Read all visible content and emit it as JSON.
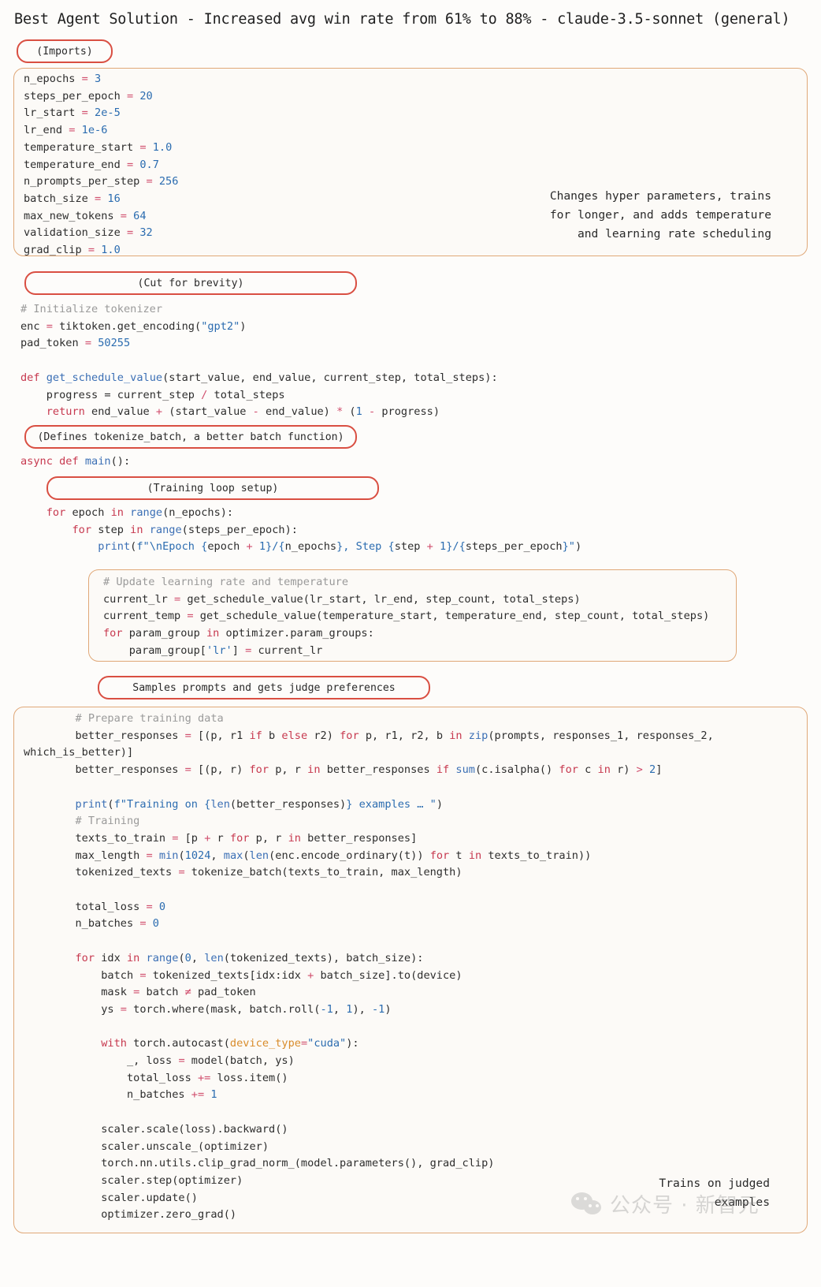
{
  "title": "Best Agent Solution - Increased avg win rate from 61% to 88% - claude-3.5-sonnet (general)",
  "annotations": {
    "imports": "(Imports)",
    "cut_for_brevity": "(Cut for brevity)",
    "defines_tokenize_batch": "(Defines tokenize_batch, a better batch function)",
    "training_loop_setup": "(Training loop setup)",
    "samples_prompts": "Samples prompts and gets judge preferences"
  },
  "sidenotes": {
    "hyperparams": "Changes hyper parameters, trains\nfor longer, and adds temperature\nand learning rate scheduling",
    "trains_on_judged": "Trains on judged\nexamples"
  },
  "hyperparams": {
    "lines": [
      {
        "name": "n_epochs",
        "value": "3"
      },
      {
        "name": "steps_per_epoch",
        "value": "20"
      },
      {
        "name": "lr_start",
        "value": "2e-5"
      },
      {
        "name": "lr_end",
        "value": "1e-6"
      },
      {
        "name": "temperature_start",
        "value": "1.0"
      },
      {
        "name": "temperature_end",
        "value": "0.7"
      },
      {
        "name": "n_prompts_per_step",
        "value": "256"
      },
      {
        "name": "batch_size",
        "value": "16"
      },
      {
        "name": "max_new_tokens",
        "value": "64"
      },
      {
        "name": "validation_size",
        "value": "32"
      },
      {
        "name": "grad_clip",
        "value": "1.0"
      }
    ]
  },
  "code": {
    "tokenizer_block": [
      "# Initialize tokenizer",
      "enc = tiktoken.get_encoding(\"gpt2\")",
      "pad_token = 50255",
      "",
      "def get_schedule_value(start_value, end_value, current_step, total_steps):",
      "    progress = current_step / total_steps",
      "    return end_value + (start_value - end_value) * (1 - progress)"
    ],
    "async_main": "async def main():",
    "loop_lines": [
      "    for epoch in range(n_epochs):",
      "        for step in range(steps_per_epoch):",
      "            print(f\"\\nEpoch {epoch + 1}/{n_epochs}, Step {step + 1}/{steps_per_epoch}\")"
    ],
    "lr_block": [
      "# Update learning rate and temperature",
      "current_lr = get_schedule_value(lr_start, lr_end, step_count, total_steps)",
      "current_temp = get_schedule_value(temperature_start, temperature_end, step_count, total_steps)",
      "for param_group in optimizer.param_groups:",
      "    param_group['lr'] = current_lr"
    ],
    "training_block": [
      "# Prepare training data",
      "better_responses = [(p, r1 if b else r2) for p, r1, r2, b in zip(prompts, responses_1, responses_2, which_is_better)]",
      "better_responses = [(p, r) for p, r in better_responses if sum(c.isalpha() for c in r) > 2]",
      "",
      "print(f\"Training on {len(better_responses)} examples ... \")",
      "# Training",
      "texts_to_train = [p + r for p, r in better_responses]",
      "max_length = min(1024, max(len(enc.encode_ordinary(t)) for t in texts_to_train))",
      "tokenized_texts = tokenize_batch(texts_to_train, max_length)",
      "",
      "total_loss = 0",
      "n_batches = 0",
      "",
      "for idx in range(0, len(tokenized_texts), batch_size):",
      "    batch = tokenized_texts[idx:idx + batch_size].to(device)",
      "    mask = batch ≠ pad_token",
      "    ys = torch.where(mask, batch.roll(-1, 1), -1)",
      "",
      "    with torch.autocast(device_type=\"cuda\"):",
      "        _, loss = model(batch, ys)",
      "        total_loss += loss.item()",
      "        n_batches += 1",
      "",
      "    scaler.scale(loss).backward()",
      "    scaler.unscale_(optimizer)",
      "    torch.nn.utils.clip_grad_norm_(model.parameters(), grad_clip)",
      "    scaler.step(optimizer)",
      "    scaler.update()",
      "    optimizer.zero_grad()"
    ]
  },
  "watermark": {
    "text": "公众号 · 新智元",
    "icon": "wechat-icon"
  },
  "colors": {
    "pill_border": "#d94f42",
    "code_border": "#e0a878",
    "code_bg": "#fcfaf7",
    "page_bg": "#fdfcfa",
    "keyword": "#c7394f",
    "function": "#3b6fb5",
    "number": "#2b6cb0",
    "comment": "#9a9a9a"
  }
}
